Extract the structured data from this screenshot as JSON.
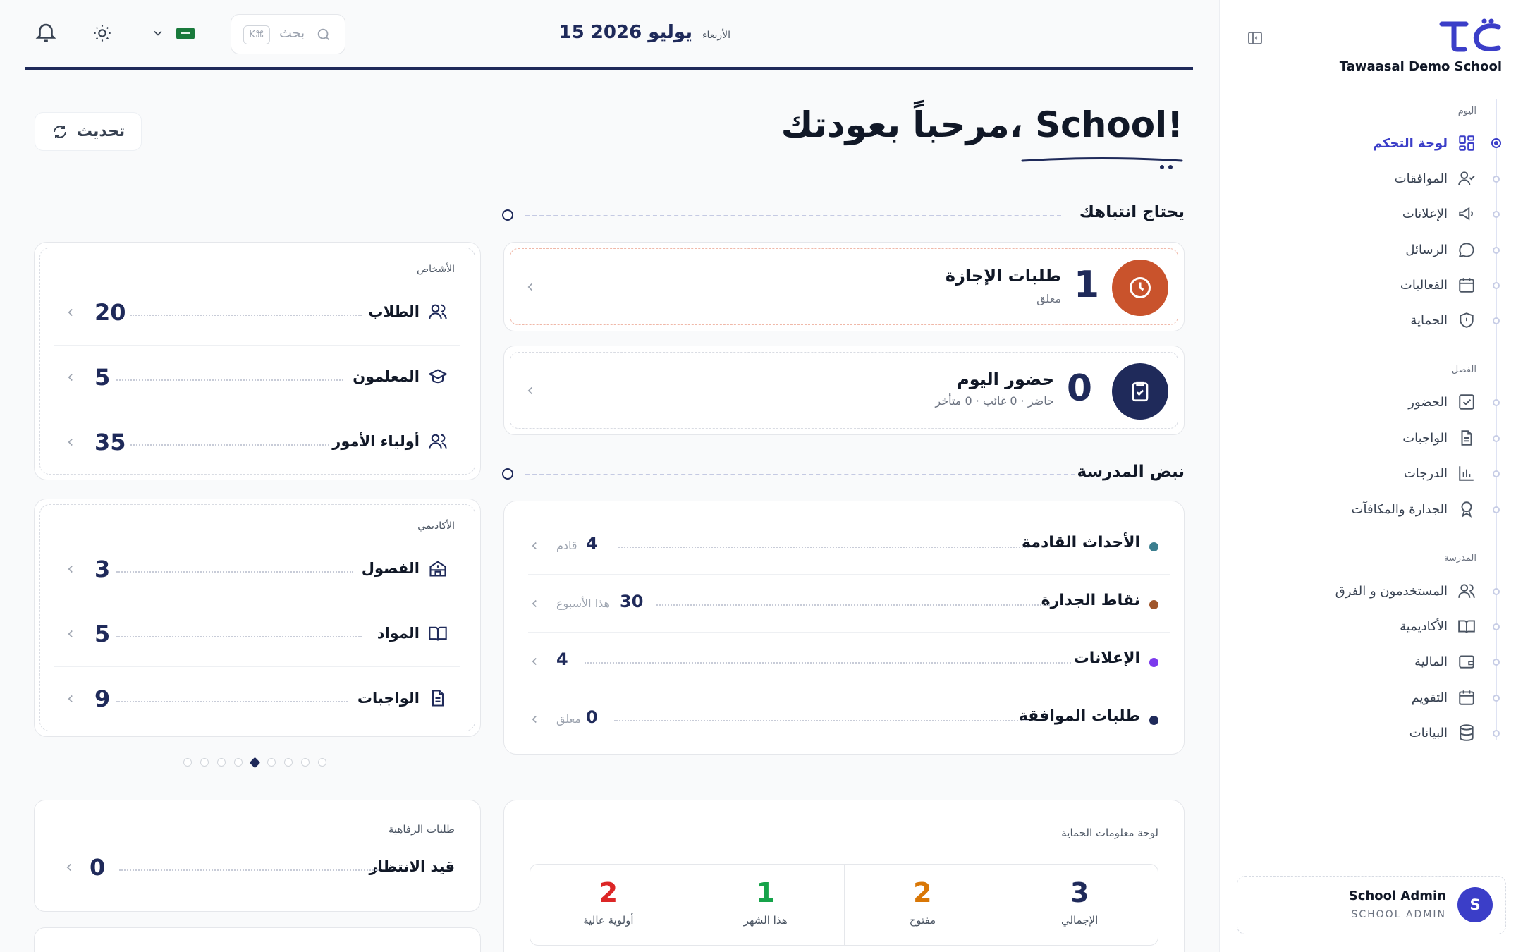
{
  "sidebar": {
    "school_name": "Tawaasal Demo School",
    "sections": {
      "today": "اليوم",
      "class": "الفصل",
      "school": "المدرسة"
    },
    "items": [
      {
        "label": "لوحة التحكم",
        "icon": "dashboard-icon",
        "active": true
      },
      {
        "label": "الموافقات",
        "icon": "user-check-icon"
      },
      {
        "label": "الإعلانات",
        "icon": "megaphone-icon"
      },
      {
        "label": "الرسائل",
        "icon": "chat-icon"
      },
      {
        "label": "الفعاليات",
        "icon": "calendar-icon"
      },
      {
        "label": "الحماية",
        "icon": "shield-icon"
      },
      {
        "label": "الحضور",
        "icon": "check-square-icon"
      },
      {
        "label": "الواجبات",
        "icon": "document-icon"
      },
      {
        "label": "الدرجات",
        "icon": "bar-chart-icon"
      },
      {
        "label": "الجدارة والمكافآت",
        "icon": "award-icon"
      },
      {
        "label": "المستخدمون و الفرق",
        "icon": "users-icon"
      },
      {
        "label": "الأكاديمية",
        "icon": "book-icon"
      },
      {
        "label": "المالية",
        "icon": "wallet-icon"
      },
      {
        "label": "التقويم",
        "icon": "calendar-icon"
      },
      {
        "label": "البيانات",
        "icon": "database-icon"
      }
    ],
    "user": {
      "initial": "S",
      "name": "School Admin",
      "role": "SCHOOL ADMIN"
    }
  },
  "header": {
    "day": "الأربعاء",
    "date": "15 يوليو 2026",
    "search_placeholder": "بحث",
    "search_shortcut": "K⌘",
    "language_flag": "saudi-flag-icon"
  },
  "welcome": {
    "title": "مرحباً بعودتك، School!",
    "refresh_label": "تحديث"
  },
  "attention": {
    "title": "يحتاج انتباهك",
    "cards": [
      {
        "count": "1",
        "title": "طلبات الإجازة",
        "subtitle": "معلق",
        "icon": "clock-icon",
        "color": "#c9532c"
      },
      {
        "count": "0",
        "title": "حضور اليوم",
        "subtitle": "حاضر · 0 غائب · 0 متأخر",
        "icon": "clipboard-check-icon",
        "color": "#1f2a5a"
      }
    ]
  },
  "pulse": {
    "title": "نبض المدرسة",
    "rows": [
      {
        "label": "الأحداث القادمة",
        "value": "4",
        "unit": "قادم",
        "color": "#3b7e8f"
      },
      {
        "label": "نقاط الجدارة",
        "value": "30",
        "unit": "هذا الأسبوع",
        "color": "#a0562c"
      },
      {
        "label": "الإعلانات",
        "value": "4",
        "unit": "",
        "color": "#7c3aed"
      },
      {
        "label": "طلبات الموافقة",
        "value": "0",
        "unit": "معلق",
        "color": "#1f2a5a"
      }
    ]
  },
  "people": {
    "caption": "الأشخاص",
    "rows": [
      {
        "label": "الطلاب",
        "value": "20",
        "icon": "users-icon"
      },
      {
        "label": "المعلمون",
        "value": "5",
        "icon": "graduation-cap-icon"
      },
      {
        "label": "أولياء الأمور",
        "value": "35",
        "icon": "users-icon"
      }
    ]
  },
  "academic": {
    "caption": "الأكاديمي",
    "rows": [
      {
        "label": "الفصول",
        "value": "3",
        "icon": "school-icon"
      },
      {
        "label": "المواد",
        "value": "5",
        "icon": "book-open-icon"
      },
      {
        "label": "الواجبات",
        "value": "9",
        "icon": "document-icon"
      }
    ]
  },
  "pager": {
    "count": 9,
    "active": 5
  },
  "welfare": {
    "caption": "طلبات الرفاهية",
    "label": "قيد الانتظار",
    "value": "0"
  },
  "protection": {
    "caption": "لوحة معلومات الحماية",
    "stats": [
      {
        "label": "الإجمالي",
        "value": "3",
        "color": "#1f2a5a"
      },
      {
        "label": "مفتوح",
        "value": "2",
        "color": "#d97706"
      },
      {
        "label": "هذا الشهر",
        "value": "1",
        "color": "#16a34a"
      },
      {
        "label": "أولوية عالية",
        "value": "2",
        "color": "#dc2626"
      }
    ]
  }
}
